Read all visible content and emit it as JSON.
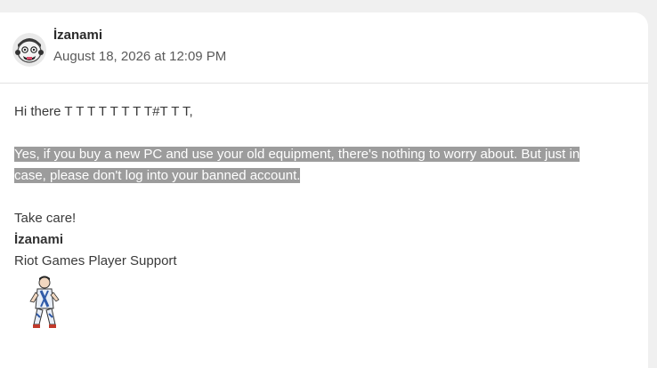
{
  "post": {
    "author": "İzanami",
    "timestamp": "August 18, 2026 at 12:09 PM",
    "greeting": "Hi there T T T T T T T T#T T T,",
    "highlighted_line_1": "Yes, if you buy a new PC and use your old equipment, there's nothing to worry about. But just in",
    "highlighted_line_2": "case, please don't log into your banned account.",
    "closing": "Take care!",
    "signature_name": "İzanami",
    "signature_team": "Riot Games Player Support"
  },
  "icons": {
    "avatar": "avatar-icon",
    "mascot": "mascot-icon"
  },
  "colors": {
    "highlight_bg": "#9c9c9c",
    "card_bg": "#ffffff",
    "page_bg": "#f0f0f0"
  }
}
